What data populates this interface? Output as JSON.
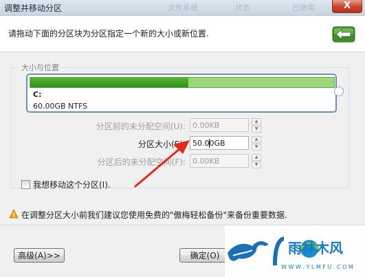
{
  "window": {
    "title": "调整并移动分区",
    "faint_bg_1": "文件系统",
    "faint_bg_2": "状态",
    "faint_bg_3": "已使用",
    "close_label": "X"
  },
  "header": {
    "instruction": "请拖动下面的分区块为分区指定一个新的大小或新位置."
  },
  "group": {
    "legend": "大小与位置",
    "partition": {
      "drive": "C:",
      "info": "60.00GB NTFS",
      "used_fraction": 0.52
    }
  },
  "fields": {
    "before": {
      "label": "分区前的未分配空间(U):",
      "value": "0.00KB"
    },
    "size": {
      "label": "分区大小(S):",
      "value": "50.00GB"
    },
    "after": {
      "label": "分区后的未分配空间(F):",
      "value": "0.00KB"
    }
  },
  "move_checkbox": {
    "label": "我想移动这个分区(I).",
    "checked": false
  },
  "warning": {
    "text": "在调整分区大小前我们建议您使用免费的\"傲梅轻松备份\"来备份重要数据."
  },
  "buttons": {
    "advanced": "高级(A)>>",
    "ok": "确定(O)"
  },
  "watermark": {
    "brand_text": "雨林木风",
    "url_text": "W W W . Y L M F U . C O M"
  },
  "colors": {
    "accent_green": "#2f8f1b",
    "free_green": "#9ed67b",
    "annotation_red": "#e02a1a",
    "title_bar": "#c8d5e2"
  }
}
